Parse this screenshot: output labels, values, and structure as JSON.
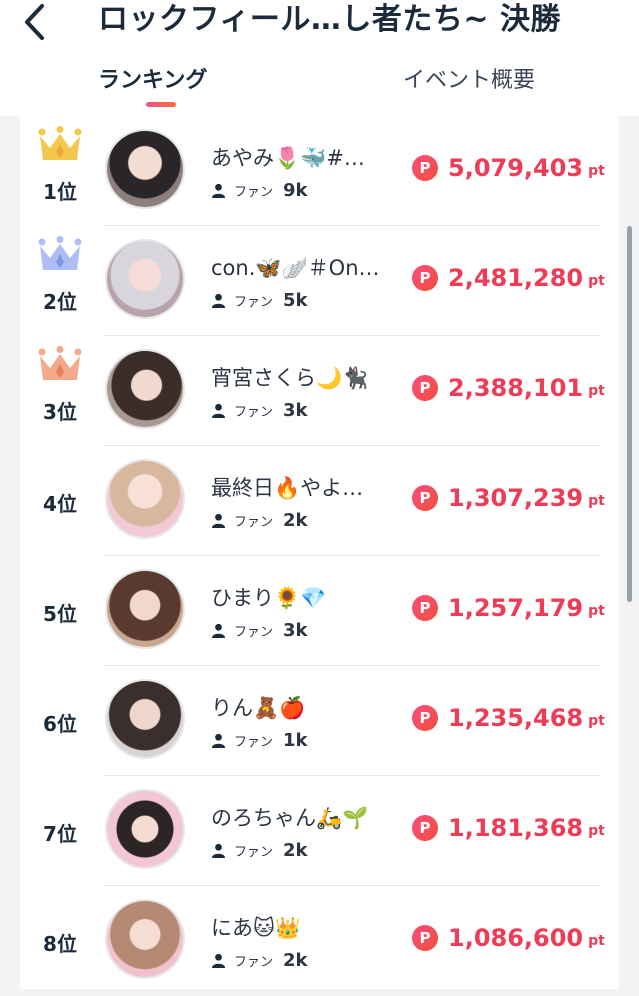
{
  "header": {
    "title": "ロックフィール…し者たち~ 決勝",
    "tabs": [
      {
        "label": "ランキング",
        "active": true
      },
      {
        "label": "イベント概要",
        "active": false
      }
    ]
  },
  "ranking": [
    {
      "rank": "1位",
      "name": "あやみ🌷🐳#…",
      "fan_label": "ファン",
      "fans": "9k",
      "points": "5,079,403",
      "unit": "pt"
    },
    {
      "rank": "2位",
      "name": "con.🦋🪽＃On…",
      "fan_label": "ファン",
      "fans": "5k",
      "points": "2,481,280",
      "unit": "pt"
    },
    {
      "rank": "3位",
      "name": "宵宮さくら🌙🐈‍⬛",
      "fan_label": "ファン",
      "fans": "3k",
      "points": "2,388,101",
      "unit": "pt"
    },
    {
      "rank": "4位",
      "name": "最終日🔥やよ…",
      "fan_label": "ファン",
      "fans": "2k",
      "points": "1,307,239",
      "unit": "pt"
    },
    {
      "rank": "5位",
      "name": "ひまり🌻💎",
      "fan_label": "ファン",
      "fans": "3k",
      "points": "1,257,179",
      "unit": "pt"
    },
    {
      "rank": "6位",
      "name": "りん🧸🍎",
      "fan_label": "ファン",
      "fans": "1k",
      "points": "1,235,468",
      "unit": "pt"
    },
    {
      "rank": "7位",
      "name": "のろちゃん🛵🌱",
      "fan_label": "ファン",
      "fans": "2k",
      "points": "1,181,368",
      "unit": "pt"
    },
    {
      "rank": "8位",
      "name": "にあ🐱👑",
      "fan_label": "ファン",
      "fans": "2k",
      "points": "1,086,600",
      "unit": "pt"
    }
  ],
  "badge_letter": "P",
  "colors": {
    "accent_points": "#ee3b56",
    "crown_gold": "#f3c94d",
    "crown_silver": "#aebdf5",
    "crown_bronze": "#f3a98c"
  },
  "icons": {
    "back": "chevron-left-icon",
    "fan": "person-icon",
    "crown": "crown-icon",
    "point": "point-badge-icon"
  }
}
